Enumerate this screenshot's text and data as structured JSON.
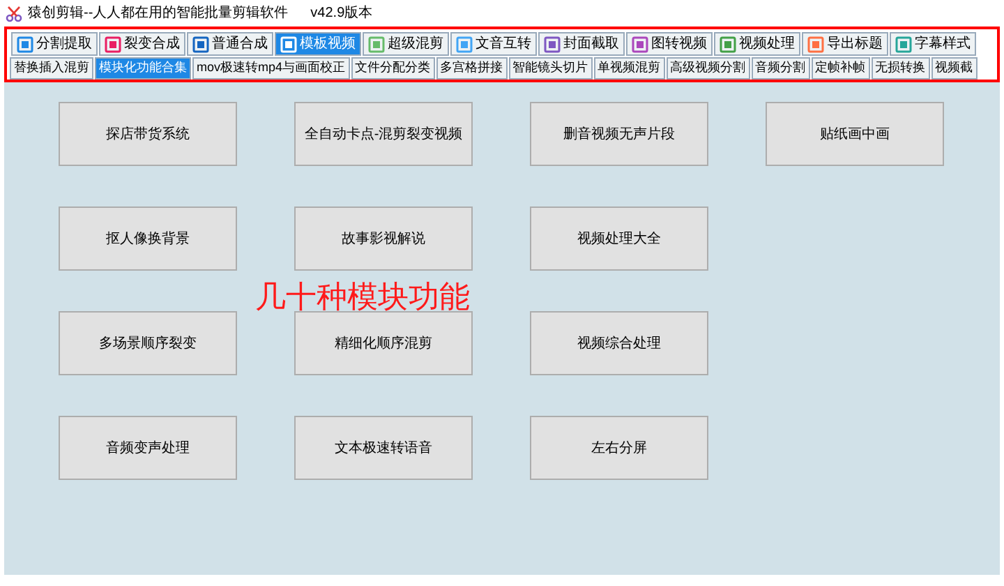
{
  "window": {
    "title": "猿创剪辑--人人都在用的智能批量剪辑软件",
    "version": "v42.9版本"
  },
  "tabs": [
    {
      "label": "分割提取",
      "selected": false
    },
    {
      "label": "裂变合成",
      "selected": false
    },
    {
      "label": "普通合成",
      "selected": false
    },
    {
      "label": "模板视频",
      "selected": true
    },
    {
      "label": "超级混剪",
      "selected": false
    },
    {
      "label": "文音互转",
      "selected": false
    },
    {
      "label": "封面截取",
      "selected": false
    },
    {
      "label": "图转视频",
      "selected": false
    },
    {
      "label": "视频处理",
      "selected": false
    },
    {
      "label": "导出标题",
      "selected": false
    },
    {
      "label": "字幕样式",
      "selected": false
    }
  ],
  "subtabs": [
    {
      "label": "替换插入混剪",
      "selected": false
    },
    {
      "label": "模块化功能合集",
      "selected": true
    },
    {
      "label": "mov极速转mp4与画面校正",
      "selected": false
    },
    {
      "label": "文件分配分类",
      "selected": false
    },
    {
      "label": "多宫格拼接",
      "selected": false
    },
    {
      "label": "智能镜头切片",
      "selected": false
    },
    {
      "label": "单视频混剪",
      "selected": false
    },
    {
      "label": "高级视频分割",
      "selected": false
    },
    {
      "label": "音频分割",
      "selected": false
    },
    {
      "label": "定帧补帧",
      "selected": false
    },
    {
      "label": "无损转换",
      "selected": false
    },
    {
      "label": "视频截",
      "selected": false
    }
  ],
  "modules": [
    [
      "探店带货系统",
      "全自动卡点-混剪裂变视频",
      "删音视频无声片段",
      "贴纸画中画"
    ],
    [
      "抠人像换背景",
      "故事影视解说",
      "视频处理大全"
    ],
    [
      "多场景顺序裂变",
      "精细化顺序混剪",
      "视频综合处理"
    ],
    [
      "音频变声处理",
      "文本极速转语音",
      "左右分屏"
    ]
  ],
  "annotation": "几十种模块功能"
}
